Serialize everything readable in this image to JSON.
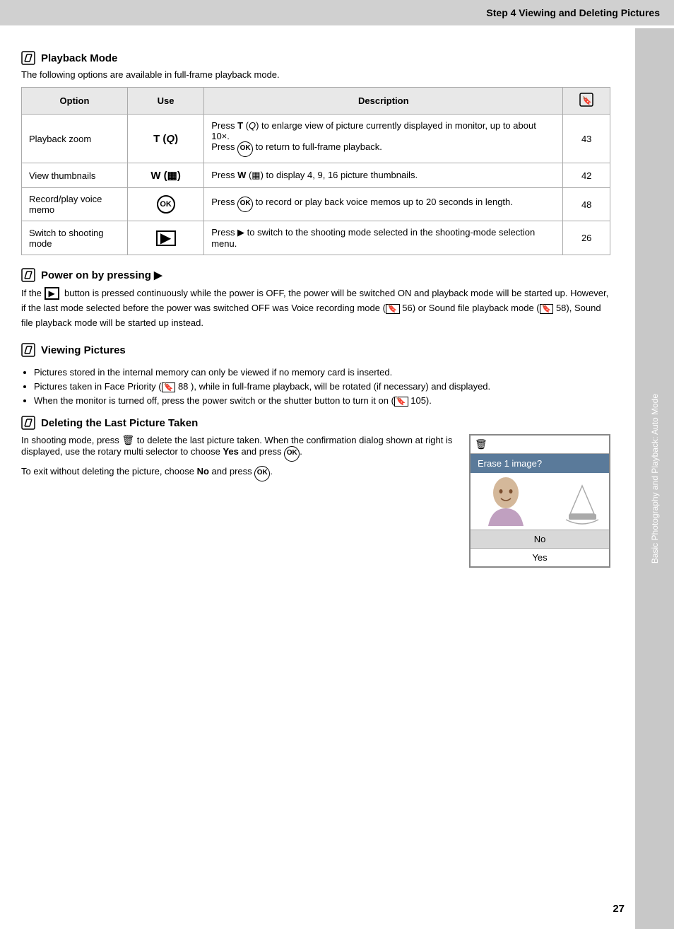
{
  "header": {
    "title": "Step 4 Viewing and Deleting Pictures"
  },
  "playback_mode": {
    "section_title": "Playback Mode",
    "subtitle": "The following options are available in full-frame playback mode.",
    "table": {
      "headers": [
        "Option",
        "Use",
        "Description",
        ""
      ],
      "rows": [
        {
          "option": "Playback zoom",
          "use_symbol": "T (🔍)",
          "use_display": "T (Q)",
          "description": "Press T (Q) to enlarge view of picture currently displayed in monitor, up to about 10×.\nPress OK to return to full-frame playback.",
          "ref": "43"
        },
        {
          "option": "View thumbnails",
          "use_display": "W (⊞)",
          "description": "Press W (⊞) to display 4, 9, 16 picture thumbnails.",
          "ref": "42"
        },
        {
          "option": "Record/play voice memo",
          "use_display": "OK",
          "description": "Press OK to record or play back voice memos up to 20 seconds in length.",
          "ref": "48"
        },
        {
          "option": "Switch to shooting mode",
          "use_display": "▶",
          "description": "Press ▶ to switch to the shooting mode selected in the shooting-mode selection menu.",
          "ref": "26"
        }
      ]
    }
  },
  "power_on": {
    "section_title": "Power on by pressing ▶",
    "text": "If the ▶  button is pressed continuously while the power is OFF, the power will be switched ON and playback mode will be started up. However, if the last mode selected before the power was switched OFF was Voice recording mode (🎙 56) or Sound file playback mode (🔊 58), Sound file playback mode will be started up instead."
  },
  "viewing_pictures": {
    "section_title": "Viewing Pictures",
    "bullets": [
      "Pictures stored in the internal memory can only be viewed if no memory card is inserted.",
      "Pictures taken in Face Priority (🔖 88 ), while in full-frame playback, will be rotated (if necessary) and displayed.",
      "When the monitor is turned off, press the power switch or the shutter button to turn it on (🔖 105)."
    ]
  },
  "deleting": {
    "section_title": "Deleting the Last Picture Taken",
    "text1": "In shooting mode, press 🗑 to delete the last picture taken. When the confirmation dialog shown at right is displayed, use the rotary multi selector to choose Yes and press OK.",
    "text2": "To exit without deleting the picture, choose No and press OK.",
    "dialog": {
      "trash_icon": "🗑",
      "question": "Erase 1 image?",
      "no_label": "No",
      "yes_label": "Yes"
    }
  },
  "sidebar": {
    "text": "Basic Photography and Playback: Auto Mode"
  },
  "page_number": "27"
}
